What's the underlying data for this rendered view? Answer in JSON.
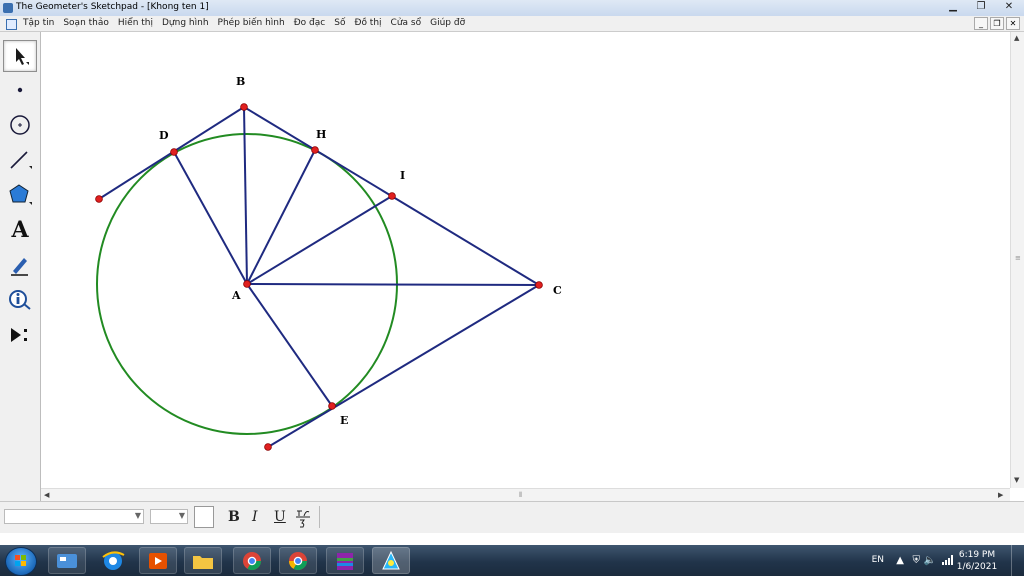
{
  "window": {
    "title": "The Geometer's Sketchpad - [Khong ten 1]"
  },
  "menu": {
    "items": [
      "Tập tin",
      "Soạn thảo",
      "Hiển thị",
      "Dựng hình",
      "Phép biến hình",
      "Đo đạc",
      "Số",
      "Đồ thị",
      "Cửa sổ",
      "Giúp đỡ"
    ]
  },
  "toolbox": {
    "text_tool_glyph": "A"
  },
  "sketch": {
    "point_labels": {
      "A": "A",
      "B": "B",
      "C": "C",
      "D": "D",
      "E": "E",
      "H": "H",
      "I": "I"
    },
    "colors": {
      "segment": "#1f2a80",
      "circle": "#228b22",
      "point": "#e02020"
    }
  },
  "formatbar": {
    "bold": "B",
    "italic": "I",
    "underline": "U"
  },
  "taskbar": {
    "language": "EN",
    "time": "6:19 PM",
    "date": "1/6/2021",
    "apps": [
      "sketchpad-icon",
      "ie-icon",
      "media-player-icon",
      "explorer-icon",
      "chrome-beta-icon",
      "chrome-icon",
      "winrar-icon",
      "gsp-icon"
    ]
  }
}
